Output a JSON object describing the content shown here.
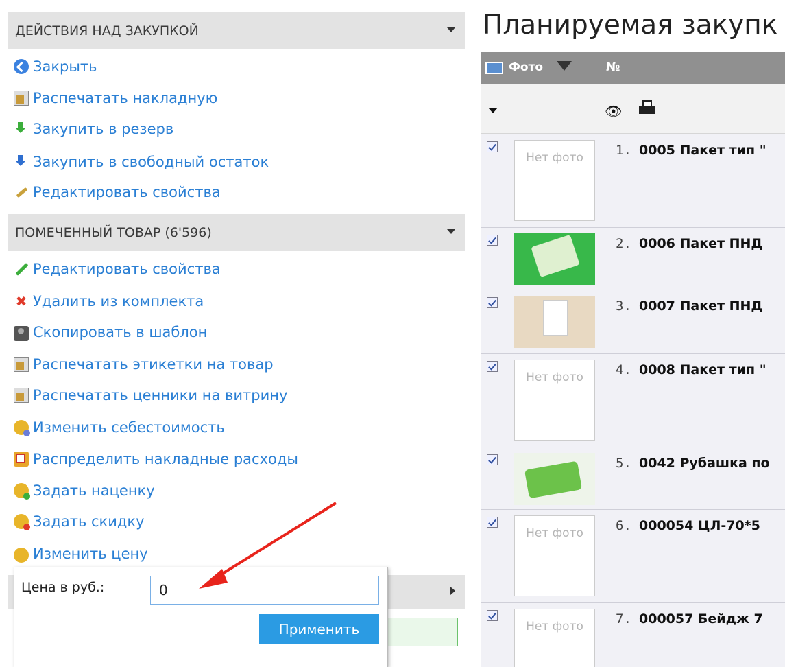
{
  "actions_section": {
    "title": "ДЕЙСТВИЯ НАД ЗАКУПКОЙ",
    "items": [
      {
        "label": "Закрыть",
        "icon": "back-arrow-icon"
      },
      {
        "label": "Распечатать накладную",
        "icon": "print-document-icon"
      },
      {
        "label": "Закупить в резерв",
        "icon": "green-download-icon"
      },
      {
        "label": "Закупить в свободный остаток",
        "icon": "blue-download-icon"
      },
      {
        "label": "Редактировать свойства",
        "icon": "wrench-icon"
      }
    ]
  },
  "marked_section": {
    "title": "ПОМЕЧЕННЫЙ ТОВАР (6'596)",
    "items": [
      {
        "label": "Редактировать свойства",
        "icon": "pencil-icon"
      },
      {
        "label": "Удалить из комплекта",
        "icon": "red-x-icon"
      },
      {
        "label": "Скопировать в шаблон",
        "icon": "camera-icon"
      },
      {
        "label": "Распечатать этикетки на товар",
        "icon": "print-labels-icon"
      },
      {
        "label": "Распечатать ценники на витрину",
        "icon": "print-pricetags-icon"
      },
      {
        "label": "Изменить себестоимость",
        "icon": "coins-cost-icon"
      },
      {
        "label": "Распределить накладные расходы",
        "icon": "distribute-costs-icon"
      },
      {
        "label": "Задать наценку",
        "icon": "coins-plus-icon"
      },
      {
        "label": "Задать скидку",
        "icon": "coins-minus-icon"
      },
      {
        "label": "Изменить цену",
        "icon": "coin-icon"
      }
    ]
  },
  "price_popup": {
    "label": "Цена в руб.:",
    "value": "0",
    "apply_label": "Применить"
  },
  "main": {
    "title": "Планируемая закупк",
    "columns": {
      "photo": "Фото",
      "number": "№"
    },
    "no_photo": "Нет фото",
    "rows": [
      {
        "num": "1.",
        "name": "0005 Пакет тип \"",
        "photo": false
      },
      {
        "num": "2.",
        "name": "0006 Пакет ПНД",
        "photo": true
      },
      {
        "num": "3.",
        "name": "0007 Пакет ПНД",
        "photo": true
      },
      {
        "num": "4.",
        "name": "0008 Пакет тип \"",
        "photo": false
      },
      {
        "num": "5.",
        "name": "0042 Рубашка по",
        "photo": true
      },
      {
        "num": "6.",
        "name": "000054 ЦЛ-70*5",
        "photo": false
      },
      {
        "num": "7.",
        "name": "000057 Бейдж 7",
        "photo": false
      }
    ]
  },
  "colors": {
    "link": "#2a7fd4",
    "section_header": "#e3e3e3",
    "apply_button": "#2b9be3",
    "table_header": "#909090"
  }
}
